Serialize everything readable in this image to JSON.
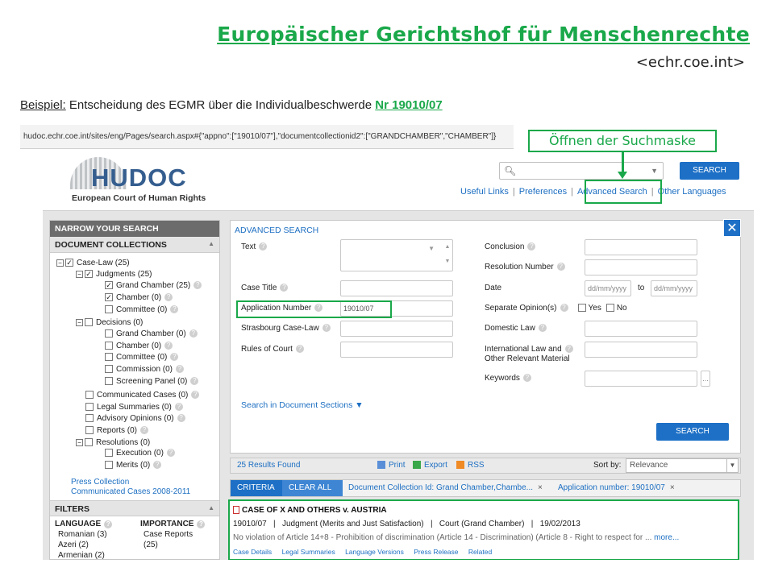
{
  "slide": {
    "title": "Europäischer Gerichtshof für Menschenrechte",
    "subtitle": "<echr.coe.int>",
    "example_label": "Beispiel:",
    "example_text": " Entscheidung des EGMR über die Individualbeschwerde ",
    "example_number": "Nr 19010/07",
    "callout": "Öffnen der Suchmaske"
  },
  "browser": {
    "url": "hudoc.echr.coe.int/sites/eng/Pages/search.aspx#{\"appno\":[\"19010/07\"],\"documentcollectionid2\":[\"GRANDCHAMBER\",\"CHAMBER\"]}"
  },
  "header": {
    "logo_text": "HUDOC",
    "logo_sub": "European Court of Human Rights",
    "search_button": "SEARCH",
    "links": [
      "Useful Links",
      "Preferences",
      "Advanced Search",
      "Other Languages"
    ],
    "separator": "|"
  },
  "left_panel": {
    "title": "NARROW YOUR SEARCH",
    "collections_title": "DOCUMENT COLLECTIONS",
    "tree": {
      "case_law": "Case-Law (25)",
      "judgments": "Judgments (25)",
      "grand_chamber": "Grand Chamber (25)",
      "chamber": "Chamber (0)",
      "committee": "Committee (0)",
      "decisions": "Decisions (0)",
      "dec_grand_chamber": "Grand Chamber (0)",
      "dec_chamber": "Chamber (0)",
      "dec_committee": "Committee (0)",
      "commission": "Commission (0)",
      "screening_panel": "Screening Panel (0)",
      "communicated_cases": "Communicated Cases (0)",
      "legal_summaries": "Legal Summaries (0)",
      "advisory_opinions": "Advisory Opinions (0)",
      "reports": "Reports (0)",
      "resolutions": "Resolutions (0)",
      "execution": "Execution (0)",
      "merits": "Merits (0)"
    },
    "press_collection": "Press Collection",
    "communicated_cases_link": "Communicated Cases 2008-2011",
    "filters_title": "FILTERS",
    "language_title": "LANGUAGE",
    "languages": [
      "Romanian (3)",
      "Azeri (2)",
      "Armenian (2)"
    ],
    "importance_title": "IMPORTANCE",
    "importance": [
      "Case Reports",
      "(25)"
    ]
  },
  "advanced": {
    "title": "ADVANCED SEARCH",
    "close": "✕",
    "text_label": "Text",
    "case_title_label": "Case Title",
    "application_number_label": "Application Number",
    "application_number_value": "19010/07",
    "strasbourg_label": "Strasbourg Case-Law",
    "rules_label": "Rules of Court",
    "conclusion_label": "Conclusion",
    "resolution_number_label": "Resolution Number",
    "date_label": "Date",
    "date_placeholder": "dd/mm/yyyy",
    "date_to": "to",
    "separate_opinion_label": "Separate Opinion(s)",
    "yes": "Yes",
    "no": "No",
    "domestic_law_label": "Domestic Law",
    "international_law_label_1": "International Law and",
    "international_law_label_2": "Other Relevant Material",
    "keywords_label": "Keywords",
    "keywords_more": "...",
    "search_sections": "Search in Document Sections ▼",
    "search_button": "SEARCH",
    "help": "?"
  },
  "results": {
    "found": "25 Results Found",
    "print": "Print",
    "export": "Export",
    "rss": "RSS",
    "sort_by": "Sort by:",
    "sort_value": "Relevance",
    "criteria": "CRITERIA",
    "clear_all": "CLEAR ALL",
    "criterion_1": "Document Collection Id: Grand Chamber,Chambe...",
    "criterion_2": "Application number: 19010/07",
    "remove": "×"
  },
  "result_item": {
    "title": "CASE OF X AND OTHERS v. AUSTRIA",
    "meta": "19010/07   |   Judgment (Merits and Just Satisfaction)   |   Court (Grand Chamber)   |   19/02/2013",
    "description": "No violation of Article 14+8 - Prohibition of discrimination (Article 14 - Discrimination) (Article 8 - Right to respect for ... ",
    "more": "more...",
    "links": [
      "Case Details",
      "Legal Summaries",
      "Language Versions",
      "Press Release",
      "Related"
    ]
  },
  "colors": {
    "accent_green": "#1aa84a",
    "hudoc_blue": "#1d70c6",
    "panel_dark": "#6c6c6c"
  }
}
